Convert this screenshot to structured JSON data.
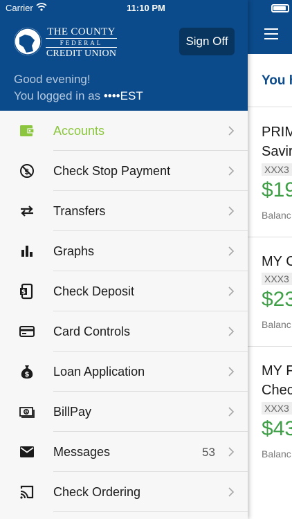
{
  "status_bar": {
    "carrier": "Carrier",
    "time": "11:10 PM"
  },
  "logo": {
    "line1": "THE COUNTY",
    "line2": "FEDERAL",
    "line3": "CREDIT UNION"
  },
  "header": {
    "sign_off_label": "Sign Off",
    "greeting": "Good evening!",
    "logged_in_prefix": "You logged in as ",
    "masked_user": "••••EST"
  },
  "menu": {
    "items": [
      {
        "label": "Accounts",
        "icon": "wallet-icon",
        "active": true
      },
      {
        "label": "Check Stop Payment",
        "icon": "stop-payment-icon"
      },
      {
        "label": "Transfers",
        "icon": "transfer-arrows-icon"
      },
      {
        "label": "Graphs",
        "icon": "bar-chart-icon"
      },
      {
        "label": "Check Deposit",
        "icon": "mobile-deposit-icon"
      },
      {
        "label": "Card Controls",
        "icon": "credit-card-icon"
      },
      {
        "label": "Loan Application",
        "icon": "money-bag-icon"
      },
      {
        "label": "BillPay",
        "icon": "bill-icon"
      },
      {
        "label": "Messages",
        "icon": "envelope-icon",
        "count": "53"
      },
      {
        "label": "Check Ordering",
        "icon": "cast-icon"
      }
    ]
  },
  "background_app": {
    "greeting_fragment": "You h",
    "accounts": [
      {
        "name_line1": "PRIM",
        "name_line2": "Savir",
        "number": "XXX3",
        "amount": "$19",
        "balance_label": "Balanc"
      },
      {
        "name_line1": "MY C",
        "number": "XXX3",
        "amount": "$23",
        "balance_label": "Balanc"
      },
      {
        "name_line1": "MY F",
        "name_line2": "Chec",
        "number": "XXX3",
        "amount": "$43",
        "balance_label": "Balanc"
      }
    ]
  },
  "colors": {
    "header_blue": "#0b4a8b",
    "sign_off_bg": "#08355f",
    "active_green": "#8cc63f",
    "amount_green": "#3f9f47"
  }
}
